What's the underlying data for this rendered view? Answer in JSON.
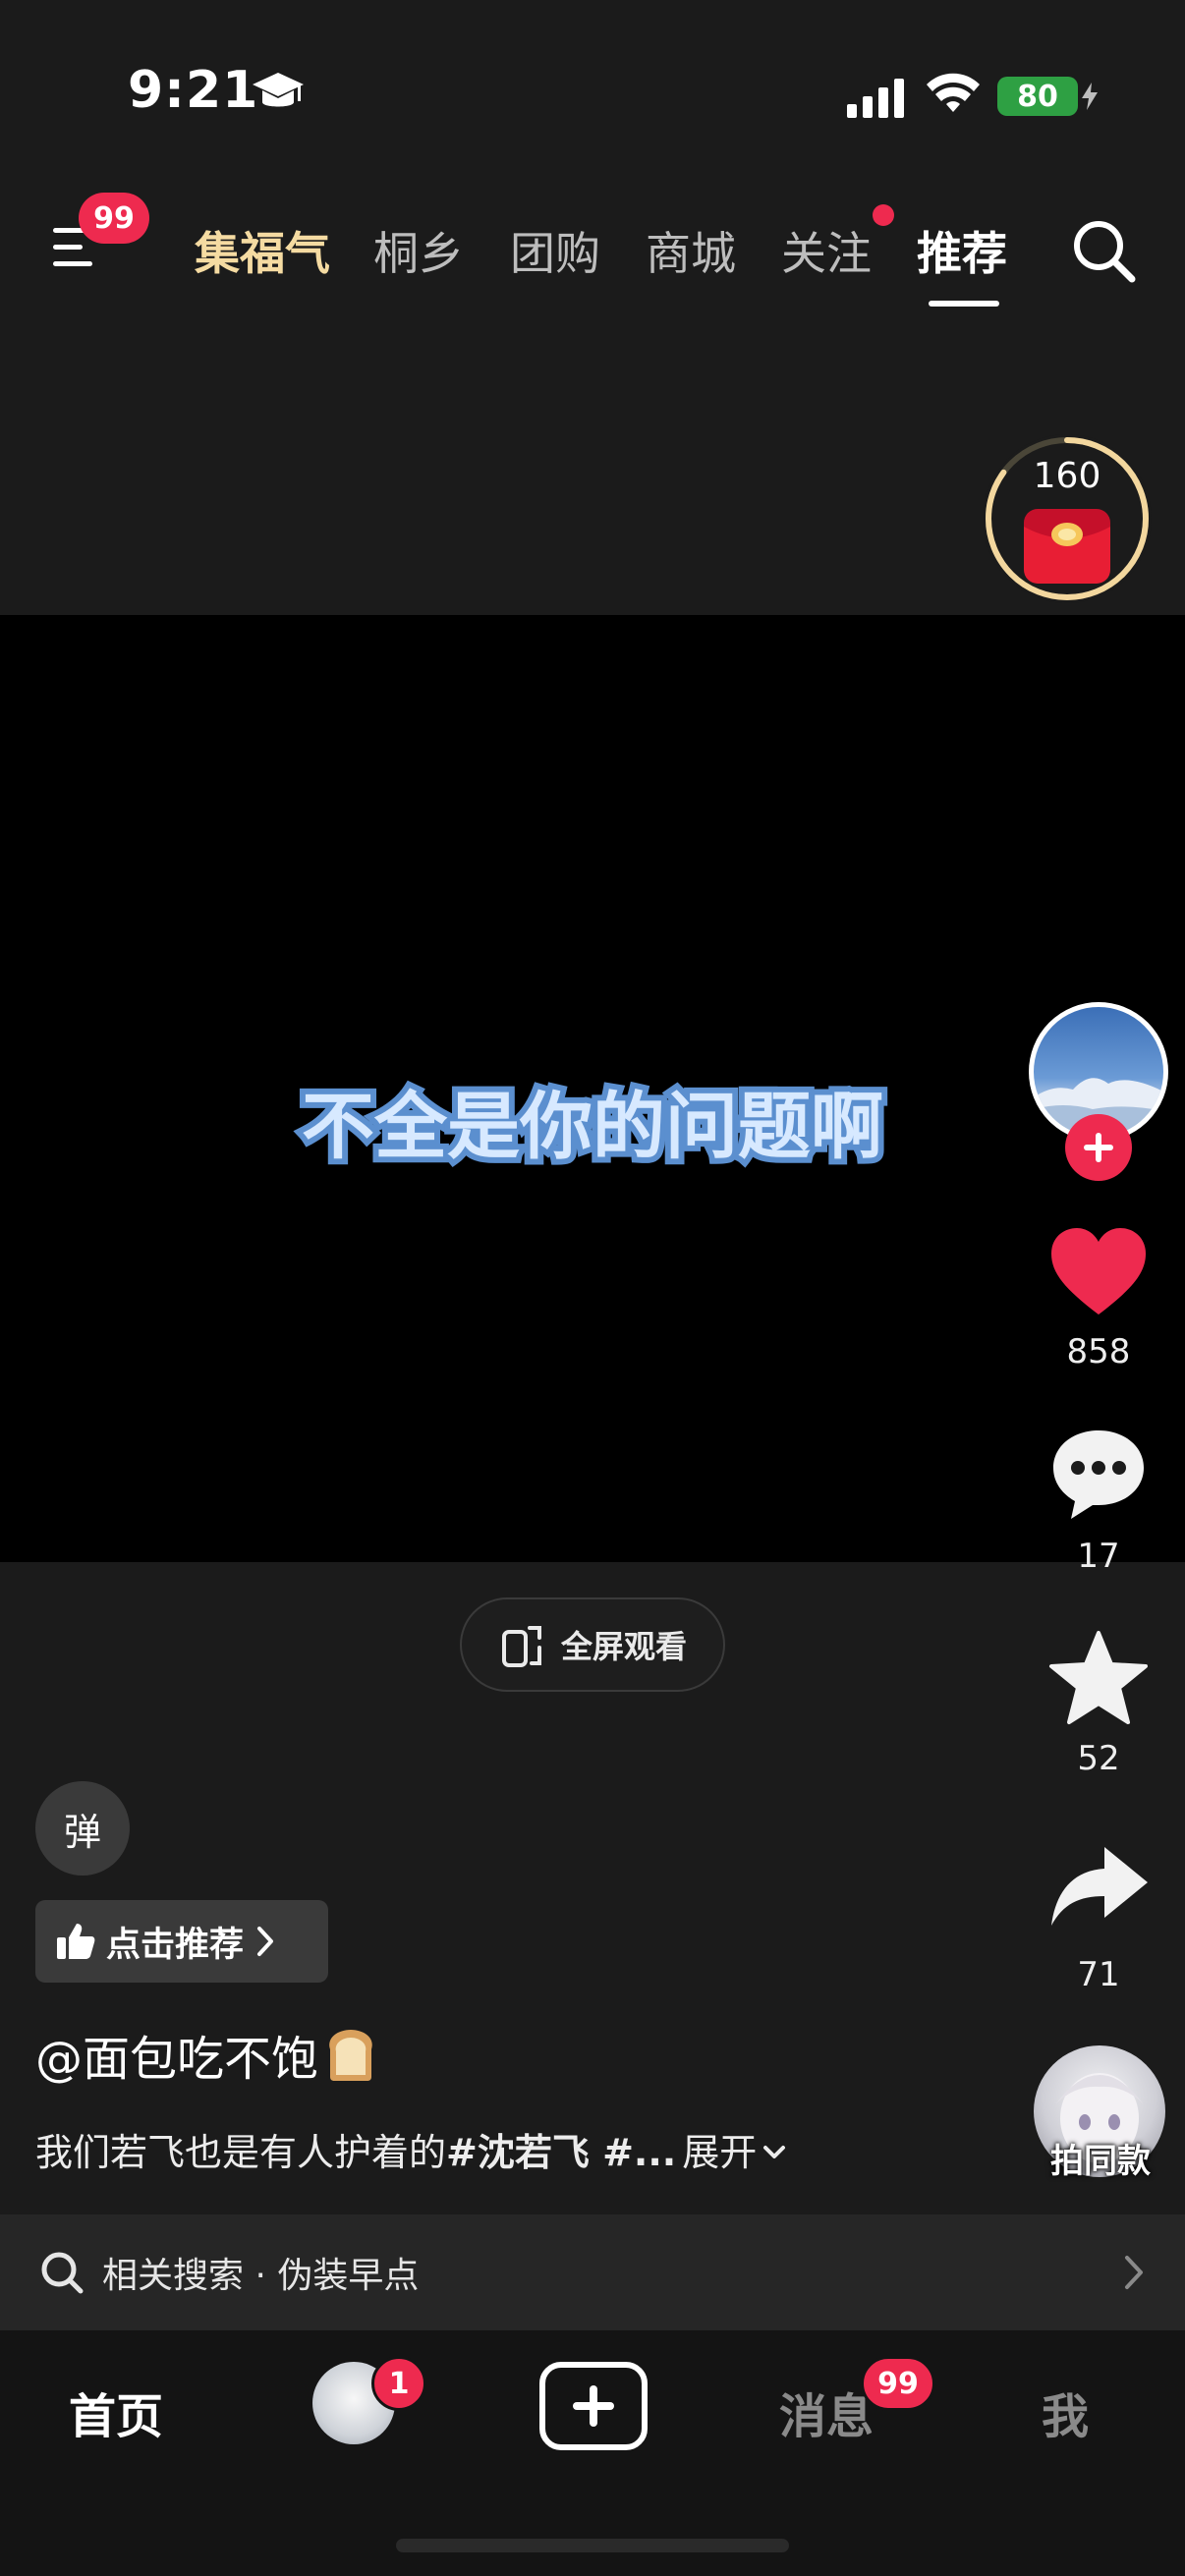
{
  "status_bar": {
    "time": "9:21",
    "battery": "80",
    "icons": [
      "graduation-cap-icon",
      "cellular-signal-icon",
      "wifi-icon",
      "battery-icon"
    ]
  },
  "top_nav": {
    "menu_badge": "99",
    "tabs": [
      {
        "label": "集福气",
        "style": "gold"
      },
      {
        "label": "桐乡"
      },
      {
        "label": "团购"
      },
      {
        "label": "商城"
      },
      {
        "label": "关注",
        "dot": true
      },
      {
        "label": "推荐",
        "active": true
      }
    ]
  },
  "coin_widget": {
    "count": "160",
    "progress": 0.85
  },
  "video": {
    "caption": "不全是你的问题啊"
  },
  "right_rail": {
    "likes": "858",
    "comments": "17",
    "favorites": "52",
    "shares": "71",
    "same_style_label": "拍同款"
  },
  "fullscreen_label": "全屏观看",
  "danmaku_label": "弹",
  "recommend_label": "点击推荐",
  "post": {
    "author": "@面包吃不饱",
    "description_text": "我们若飞也是有人护着的",
    "description_tag": "#沈若飞 #...",
    "expand_label": "展开"
  },
  "related_search": {
    "text": "相关搜索 · 伪装早点"
  },
  "tab_bar": {
    "home": "首页",
    "friends_badge": "1",
    "messages": "消息",
    "messages_badge": "99",
    "me": "我"
  },
  "colors": {
    "accent_red": "#ee2a4f",
    "gold": "#f5dba2",
    "background": "#1b1b1b"
  }
}
